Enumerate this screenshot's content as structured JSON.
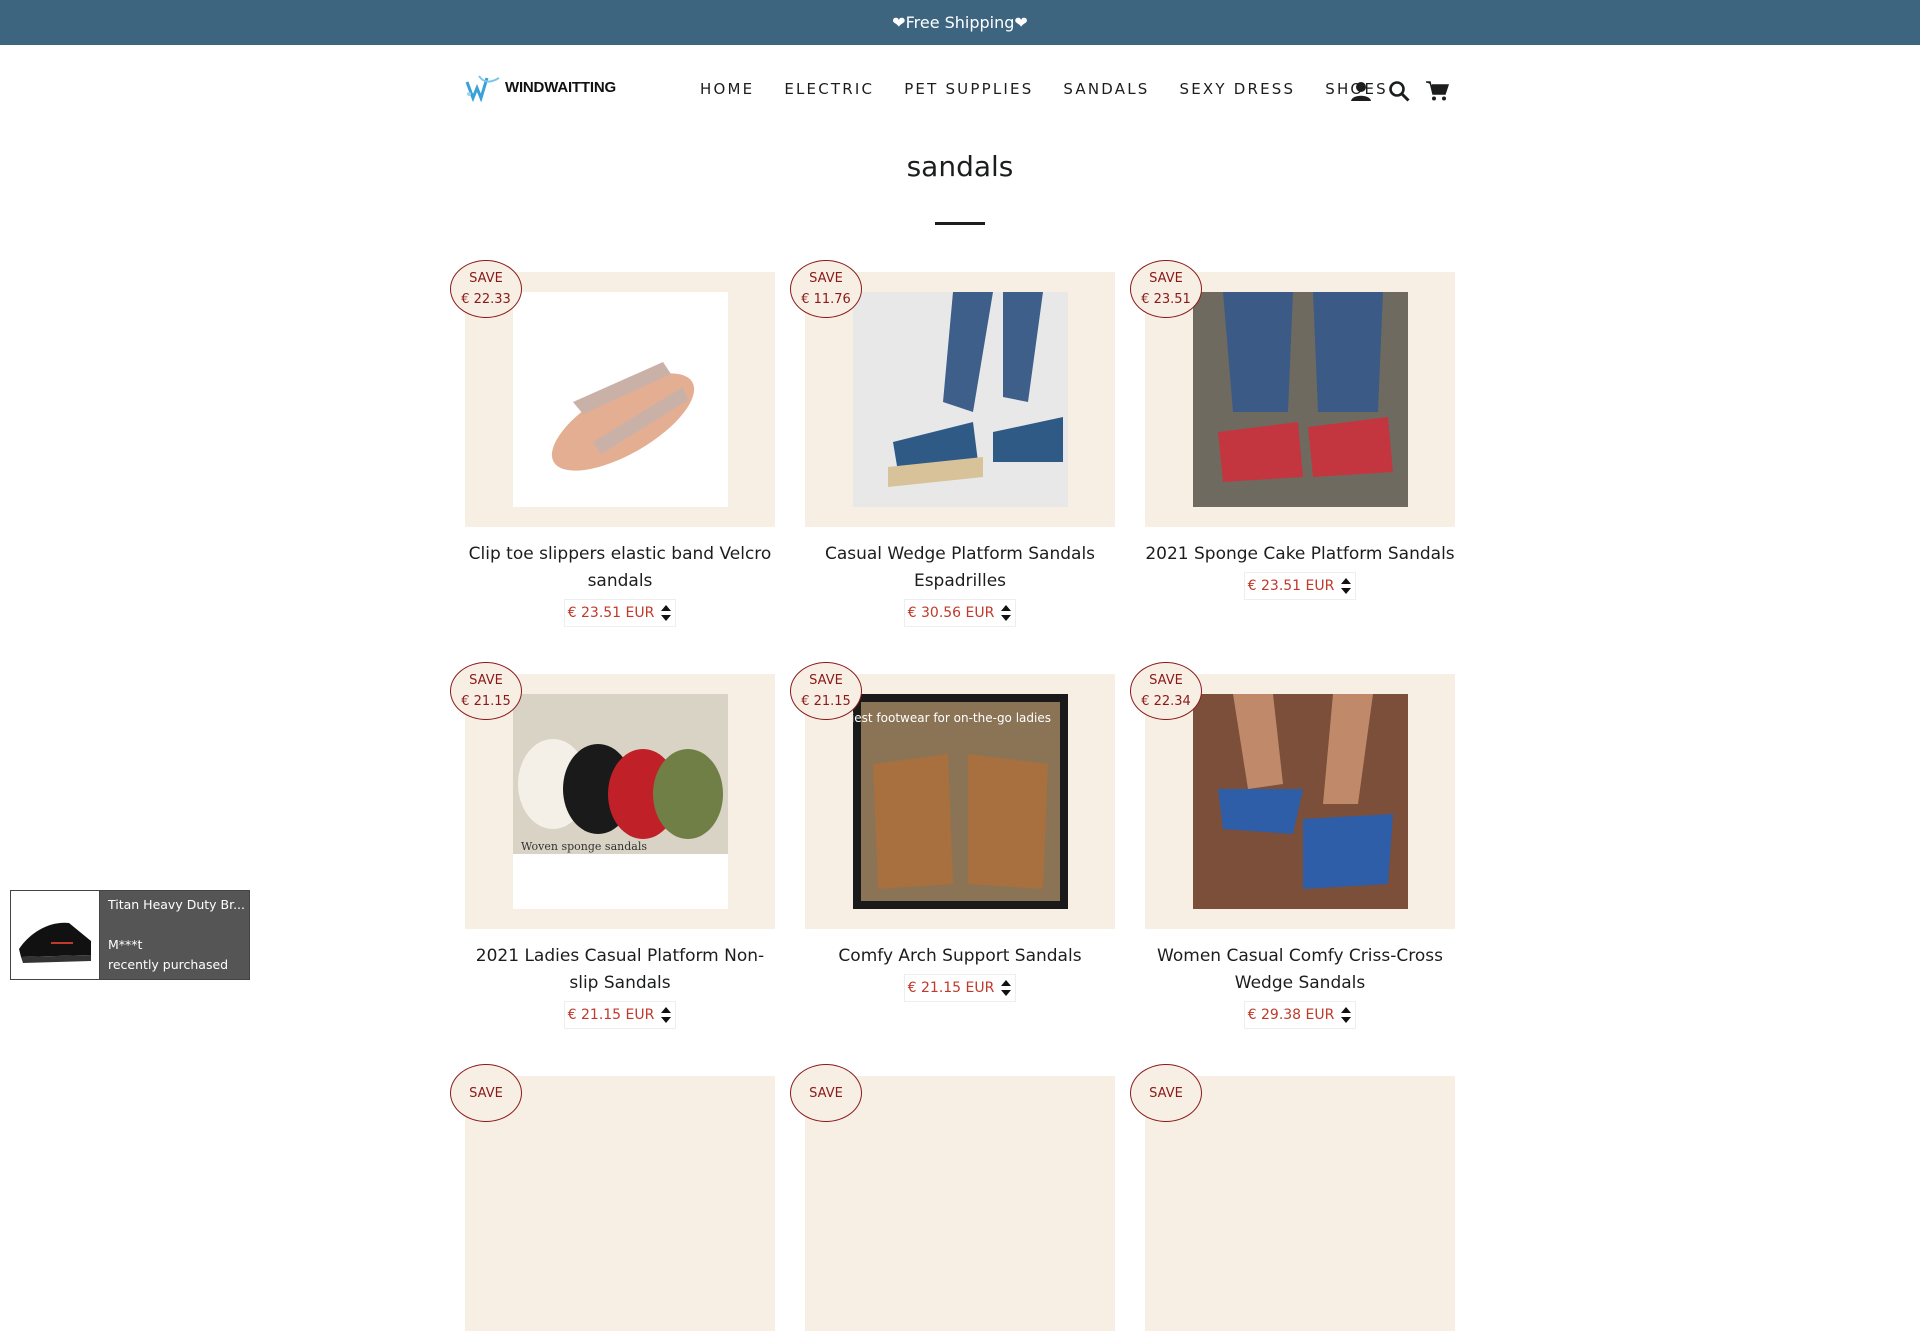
{
  "announcement": {
    "text": "❤Free Shipping❤"
  },
  "brand": {
    "name": "WINDWAITTING"
  },
  "nav": {
    "items": [
      {
        "label": "HOME"
      },
      {
        "label": "ELECTRIC"
      },
      {
        "label": "PET SUPPLIES"
      },
      {
        "label": "SANDALS"
      },
      {
        "label": "SEXY DRESS"
      },
      {
        "label": "SHOES"
      }
    ],
    "icons": [
      "account-icon",
      "search-icon",
      "cart-icon"
    ]
  },
  "page": {
    "title": "sandals"
  },
  "products": [
    {
      "save_label": "SAVE",
      "save_amount": "€ 22.33",
      "title": "Clip toe slippers elastic band Velcro sandals",
      "price": "€ 23.51 EUR"
    },
    {
      "save_label": "SAVE",
      "save_amount": "€ 11.76",
      "title": "Casual Wedge Platform Sandals Espadrilles",
      "price": "€ 30.56 EUR"
    },
    {
      "save_label": "SAVE",
      "save_amount": "€ 23.51",
      "title": "2021 Sponge Cake Platform Sandals",
      "price": "€ 23.51 EUR"
    },
    {
      "save_label": "SAVE",
      "save_amount": "€ 21.15",
      "title": "2021 Ladies Casual Platform Non-slip Sandals",
      "price": "€ 21.15 EUR"
    },
    {
      "save_label": "SAVE",
      "save_amount": "€ 21.15",
      "title": "Comfy Arch Support Sandals",
      "price": "€ 21.15 EUR",
      "image_text": "The comfiest footwear for on-the-go ladies"
    },
    {
      "save_label": "SAVE",
      "save_amount": "€ 22.34",
      "title": "Women Casual Comfy Criss-Cross Wedge Sandals",
      "price": "€ 29.38 EUR"
    },
    {
      "save_label": "SAVE"
    },
    {
      "save_label": "SAVE"
    },
    {
      "save_label": "SAVE"
    }
  ],
  "product_image_text": {
    "p4": "Woven sponge sandals"
  },
  "recent_purchase": {
    "product": "Titan Heavy Duty Br...",
    "customer": "M***t",
    "status": "recently purchased"
  },
  "colors": {
    "announcement_bg": "#3d6580",
    "card_bg": "#f8efe4",
    "badge": "#8a1a1a",
    "price": "#c0392b"
  }
}
